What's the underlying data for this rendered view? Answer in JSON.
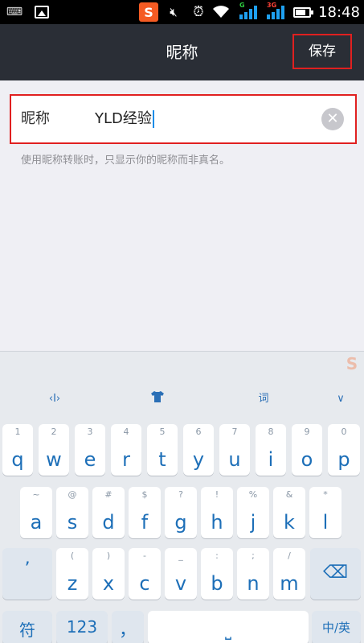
{
  "status_bar": {
    "icons": [
      "keyboard-icon",
      "image-icon",
      "sogou-icon",
      "mute-icon",
      "alarm-icon",
      "wifi-icon",
      "signal-icon",
      "signal-icon",
      "battery-icon"
    ],
    "signal1_tag": "G",
    "signal2_tag": "3G",
    "sogou_letter": "S",
    "time": "18:48"
  },
  "header": {
    "title": "昵称",
    "save_label": "保存"
  },
  "form": {
    "field_label": "昵称",
    "field_value": "YLD经验",
    "clear_symbol": "✕",
    "hint": "使用昵称转账时，只显示你的昵称而非真名。"
  },
  "keyboard": {
    "logo": "S",
    "toolbar": {
      "cursor_symbol": "‹I›",
      "skin_symbol": "▼",
      "ci_symbol": "词",
      "collapse_symbol": "∨"
    },
    "row1": [
      {
        "sub": "1",
        "key": "q"
      },
      {
        "sub": "2",
        "key": "w"
      },
      {
        "sub": "3",
        "key": "e"
      },
      {
        "sub": "4",
        "key": "r"
      },
      {
        "sub": "5",
        "key": "t"
      },
      {
        "sub": "6",
        "key": "y"
      },
      {
        "sub": "7",
        "key": "u"
      },
      {
        "sub": "8",
        "key": "i"
      },
      {
        "sub": "9",
        "key": "o"
      },
      {
        "sub": "0",
        "key": "p"
      }
    ],
    "row2": [
      {
        "sub": "~",
        "key": "a"
      },
      {
        "sub": "@",
        "key": "s"
      },
      {
        "sub": "#",
        "key": "d"
      },
      {
        "sub": "$",
        "key": "f"
      },
      {
        "sub": "?",
        "key": "g"
      },
      {
        "sub": "!",
        "key": "h"
      },
      {
        "sub": "%",
        "key": "j"
      },
      {
        "sub": "&",
        "key": "k"
      },
      {
        "sub": "*",
        "key": "l"
      }
    ],
    "row3": [
      {
        "sub": "",
        "key": "’"
      },
      {
        "sub": "(",
        "key": "z"
      },
      {
        "sub": ")",
        "key": "x"
      },
      {
        "sub": "-",
        "key": "c"
      },
      {
        "sub": "_",
        "key": "v"
      },
      {
        "sub": ":",
        "key": "b"
      },
      {
        "sub": ";",
        "key": "n"
      },
      {
        "sub": "/",
        "key": "m"
      },
      {
        "sub": "",
        "key": "⌫"
      }
    ],
    "row4": {
      "symbol_key": "符",
      "number_key": "123",
      "comma_key": "，",
      "space_key": "⎵",
      "lang_key": "中/英"
    }
  }
}
